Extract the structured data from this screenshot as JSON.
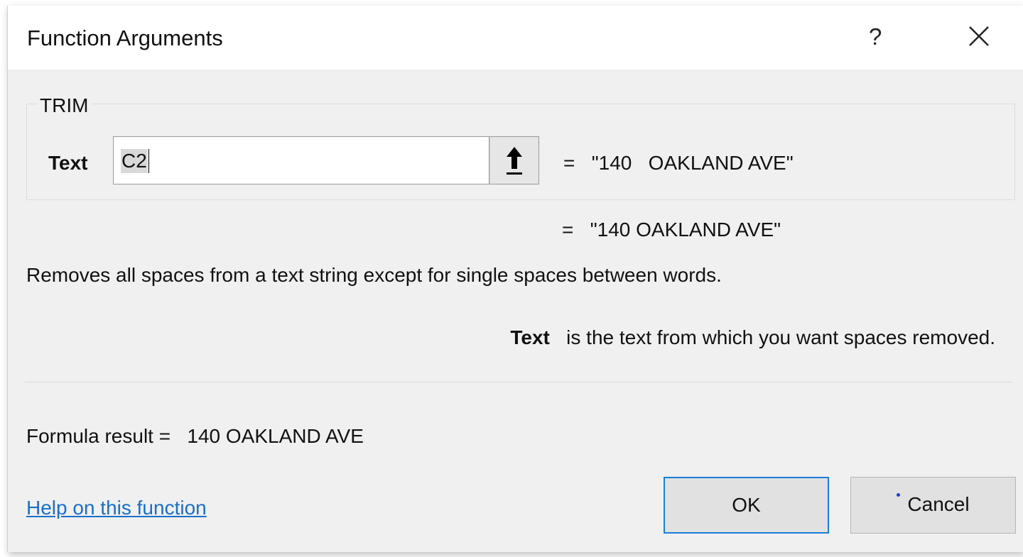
{
  "dialog": {
    "title": "Function Arguments",
    "help_glyph": "?"
  },
  "function": {
    "name": "TRIM",
    "argument": {
      "label": "Text",
      "input_value": "C2",
      "evaluated": "=   \"140   OAKLAND AVE\""
    },
    "result_preview": "=   \"140 OAKLAND AVE\"",
    "description": "Removes all spaces from a text string except for single spaces between words.",
    "argument_help": {
      "name": "Text",
      "text": "   is the text from which you want spaces removed."
    }
  },
  "formula_result": "Formula result =   140 OAKLAND AVE",
  "help_link": "Help on this function",
  "buttons": {
    "ok": "OK",
    "cancel": "Cancel"
  },
  "colors": {
    "accent": "#1a7fd6",
    "link": "#1a6fc9",
    "background": "#f0f0f0"
  },
  "icons": {
    "close": "close-icon",
    "collapse": "arrow-up-icon"
  }
}
